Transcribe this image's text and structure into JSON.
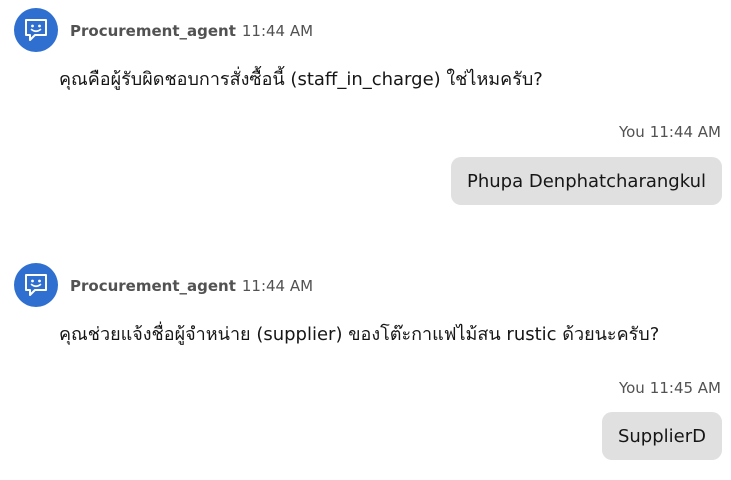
{
  "messages": [
    {
      "sender": "Procurement_agent",
      "time": "11:44 AM",
      "text": "คุณคือผู้รับผิดชอบการสั่งซื้อนี้ (staff_in_charge) ใช่ไหมครับ?"
    },
    {
      "sender": "You",
      "time": "11:44 AM",
      "text": "Phupa Denphatcharangkul"
    },
    {
      "sender": "Procurement_agent",
      "time": "11:44 AM",
      "text": "คุณช่วยแจ้งชื่อผู้จำหน่าย (supplier) ของโต๊ะกาแฟไม้สน rustic ด้วยนะครับ?"
    },
    {
      "sender": "You",
      "time": "11:45 AM",
      "text": "SupplierD"
    }
  ],
  "icons": {
    "agent_avatar": "chat-bot-icon"
  },
  "colors": {
    "avatar_bg": "#2f6fd0",
    "bubble_bg": "#e0e0e0"
  }
}
